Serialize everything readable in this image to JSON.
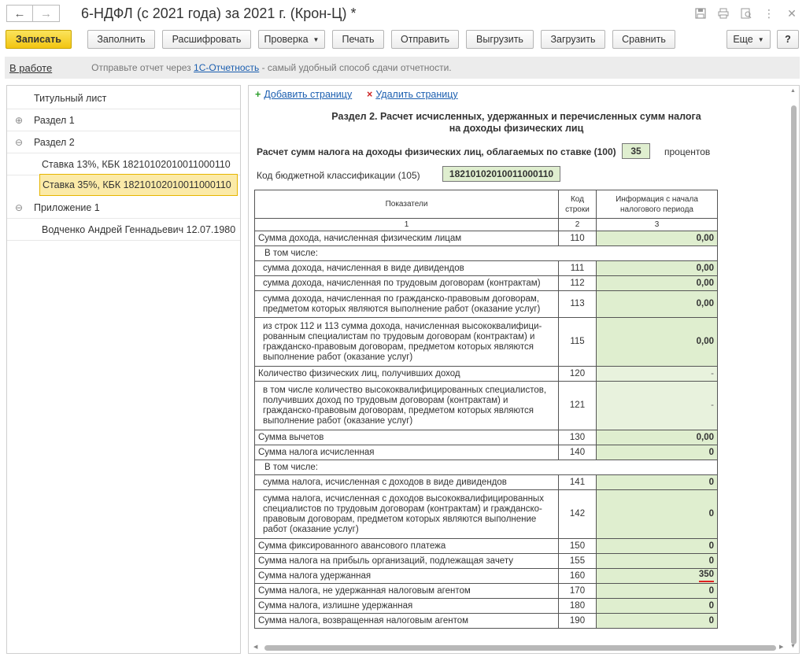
{
  "window": {
    "title": "6-НДФЛ (с 2021 года) за 2021 г. (Крон-Ц) *",
    "back_icon": "←",
    "forward_icon": "→",
    "tools": [
      "save-icon",
      "print-icon",
      "preview-icon",
      "more-icon",
      "close-icon"
    ]
  },
  "toolbar": {
    "save": "Записать",
    "fill": "Заполнить",
    "decode": "Расшифровать",
    "check": "Проверка",
    "print": "Печать",
    "send": "Отправить",
    "upload": "Выгрузить",
    "load": "Загрузить",
    "compare": "Сравнить",
    "more": "Еще",
    "help": "?"
  },
  "infobar": {
    "status": "В работе",
    "msg_before": "Отправьте отчет через ",
    "msg_link": "1С-Отчетность",
    "msg_after": " - самый удобный способ сдачи отчетности."
  },
  "tree": [
    {
      "label": "Титульный лист",
      "exp": ""
    },
    {
      "label": "Раздел 1",
      "exp": "⊕"
    },
    {
      "label": "Раздел 2",
      "exp": "⊖"
    },
    {
      "label": "Ставка 13%, КБК 18210102010011000110",
      "exp": ""
    },
    {
      "label": "Ставка 35%, КБК 18210102010011000110",
      "exp": ""
    },
    {
      "label": "Приложение 1",
      "exp": "⊖"
    },
    {
      "label": "Водченко Андрей Геннадьевич 12.07.1980",
      "exp": ""
    }
  ],
  "panel": {
    "add_page": "Добавить страницу",
    "delete_page": "Удалить страницу",
    "heading_line1": "Раздел 2. Расчет исчисленных, удержанных и перечисленных сумм налога",
    "heading_line2": "на доходы физических лиц",
    "rate_label": "Расчет сумм налога на доходы физических лиц, облагаемых по ставке  (100)",
    "rate_value": "35",
    "rate_suffix": "процентов",
    "kbk_label": "Код бюджетной классификации  (105)",
    "kbk_value": "18210102010011000110"
  },
  "table": {
    "headers": [
      "Показатели",
      "Код строки",
      "Информация с начала налогового периода"
    ],
    "header_nums": [
      "1",
      "2",
      "3"
    ],
    "rows": [
      {
        "label": "Сумма дохода, начисленная физическим лицам",
        "code": "110",
        "value": "0,00"
      },
      {
        "label": "В том числе:",
        "code": "",
        "value": ""
      },
      {
        "label": "сумма дохода, начисленная в виде дивидендов",
        "code": "111",
        "value": "0,00"
      },
      {
        "label": "сумма дохода, начисленная по трудовым договорам (контрактам)",
        "code": "112",
        "value": "0,00"
      },
      {
        "label": "сумма дохода, начисленная по гражданско-правовым договорам, предметом которых являются выполнение работ (оказание услуг)",
        "code": "113",
        "value": "0,00"
      },
      {
        "label": "из строк 112 и 113 сумма дохода, начисленная высококвалифици-рованным специалистам по трудовым договорам (контрактам) и гражданско-правовым договорам, предметом которых являются выполнение работ (оказание услуг)",
        "code": "115",
        "value": "0,00"
      },
      {
        "label": "Количество физических лиц, получивших доход",
        "code": "120",
        "value": "-"
      },
      {
        "label": "в том числе количество высококвалифицированных специалистов, получивших доход по трудовым договорам (контрактам) и гражданско-правовым договорам, предметом которых являются выполнение работ (оказание услуг)",
        "code": "121",
        "value": "-"
      },
      {
        "label": "Сумма вычетов",
        "code": "130",
        "value": "0,00"
      },
      {
        "label": "Сумма налога исчисленная",
        "code": "140",
        "value": "0"
      },
      {
        "label": "В том числе:",
        "code": "",
        "value": ""
      },
      {
        "label": "сумма налога, исчисленная с доходов в виде дивидендов",
        "code": "141",
        "value": "0"
      },
      {
        "label": "сумма налога, исчисленная с доходов высококвалифицированных специалистов по трудовым договорам (контрактам) и гражданско-правовым договорам, предметом которых являются выполнение работ (оказание услуг)",
        "code": "142",
        "value": "0"
      },
      {
        "label": "Сумма фиксированного авансового платежа",
        "code": "150",
        "value": "0"
      },
      {
        "label": "Сумма налога на прибыль организаций, подлежащая зачету",
        "code": "155",
        "value": "0"
      },
      {
        "label": "Сумма налога удержанная",
        "code": "160",
        "value": "350"
      },
      {
        "label": "Сумма налога, не удержанная налоговым агентом",
        "code": "170",
        "value": "0"
      },
      {
        "label": "Сумма налога, излишне удержанная",
        "code": "180",
        "value": "0"
      },
      {
        "label": "Сумма налога, возвращенная налоговым агентом",
        "code": "190",
        "value": "0"
      }
    ]
  }
}
